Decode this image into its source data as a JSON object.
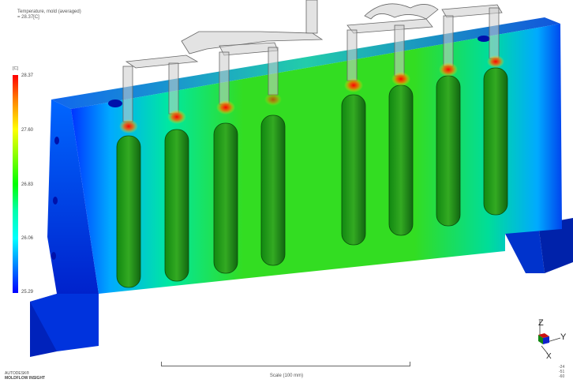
{
  "result": {
    "title_line1": "Temperature, mold (averaged)",
    "title_line2": "= 28.37[C]",
    "unit": "[C]"
  },
  "legend": {
    "ticks": [
      "28.37",
      "27.60",
      "26.83",
      "26.06",
      "25.29"
    ],
    "colors": [
      "#ff0000",
      "#ffff00",
      "#00ff00",
      "#00ffff",
      "#0000ff"
    ]
  },
  "scale": {
    "label": "Scale (100 mm)"
  },
  "brand": {
    "line1": "AUTODESK®",
    "line2": "MOLDFLOW INSIGHT"
  },
  "triad": {
    "z": "Z",
    "y": "Y",
    "x": "X"
  },
  "view": {
    "values": [
      "-24",
      "-51",
      "-60"
    ]
  }
}
